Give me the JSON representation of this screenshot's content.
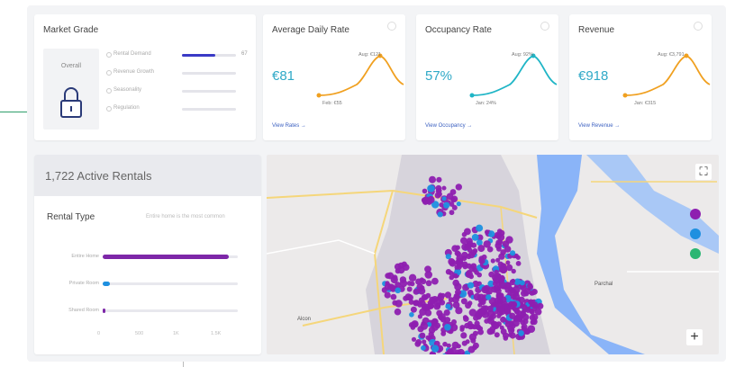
{
  "market_grade": {
    "title": "Market Grade",
    "overall_label": "Overall",
    "rows": [
      {
        "label": "Rental Demand",
        "value": "67",
        "fill": 0.62
      },
      {
        "label": "Revenue Growth",
        "value": "",
        "fill": 0
      },
      {
        "label": "Seasonality",
        "value": "",
        "fill": 0
      },
      {
        "label": "Regulation",
        "value": "",
        "fill": 0
      }
    ]
  },
  "metrics": [
    {
      "title": "Average Daily Rate",
      "value": "€81",
      "high_label": "Aug: €121",
      "low_label": "Feb: €55",
      "link": "View Rates →",
      "line_color": "#f0a020",
      "high_color": "#f0a020",
      "low_color": "#f0a020"
    },
    {
      "title": "Occupancy Rate",
      "value": "57%",
      "high_label": "Aug: 92%",
      "low_label": "Jan: 24%",
      "link": "View Occupancy →",
      "line_color": "#1fb5c6",
      "high_color": "#1fb5c6",
      "low_color": "#1fb5c6"
    },
    {
      "title": "Revenue",
      "value": "€918",
      "high_label": "Aug: €3,791",
      "low_label": "Jan: €315",
      "link": "View Revenue →",
      "line_color": "#f0a020",
      "high_color": "#f0a020",
      "low_color": "#f0a020"
    }
  ],
  "rentals": {
    "active": "1,722 Active Rentals",
    "type_title": "Rental Type",
    "type_note": "Entire home is the most common",
    "rows": [
      {
        "label": "Entire Home",
        "fill": 0.93
      },
      {
        "label": "Private Room",
        "fill": 0.05
      },
      {
        "label": "Shared Room",
        "fill": 0.005
      }
    ],
    "axis": [
      "0",
      "500",
      "1K",
      "1.5K"
    ]
  },
  "map": {
    "town_label_1": "Alcon",
    "town_label_2": "Parchal",
    "zoom_in": "+",
    "fullscreen": "⛶",
    "colors": {
      "purple": "#8e1fb0",
      "blue": "#1e90e0",
      "water": "#8ab4f8",
      "land": "#ececea",
      "road": "#f5d67a"
    }
  }
}
